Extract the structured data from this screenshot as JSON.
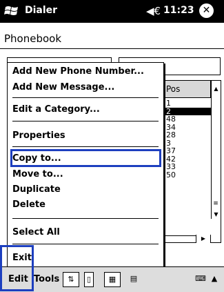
{
  "titlebar": {
    "app": "Dialer",
    "time": "11:23",
    "close": "✕"
  },
  "heading": "Phonebook",
  "list": {
    "header": "Pos",
    "rows": [
      "1",
      "2",
      "48",
      "34",
      "28",
      "3",
      "37",
      "42",
      "33",
      "50"
    ],
    "selected_index": 1
  },
  "menu": {
    "items": [
      "Add New Phone Number...",
      "Add New Message...",
      "Edit a Category...",
      "Properties",
      "Copy to...",
      "Move to...",
      "Duplicate",
      "Delete",
      "Select All",
      "Exit"
    ]
  },
  "bottombar": {
    "edit": "Edit",
    "tools": "Tools"
  },
  "highlight_color": "#1d3fbf"
}
